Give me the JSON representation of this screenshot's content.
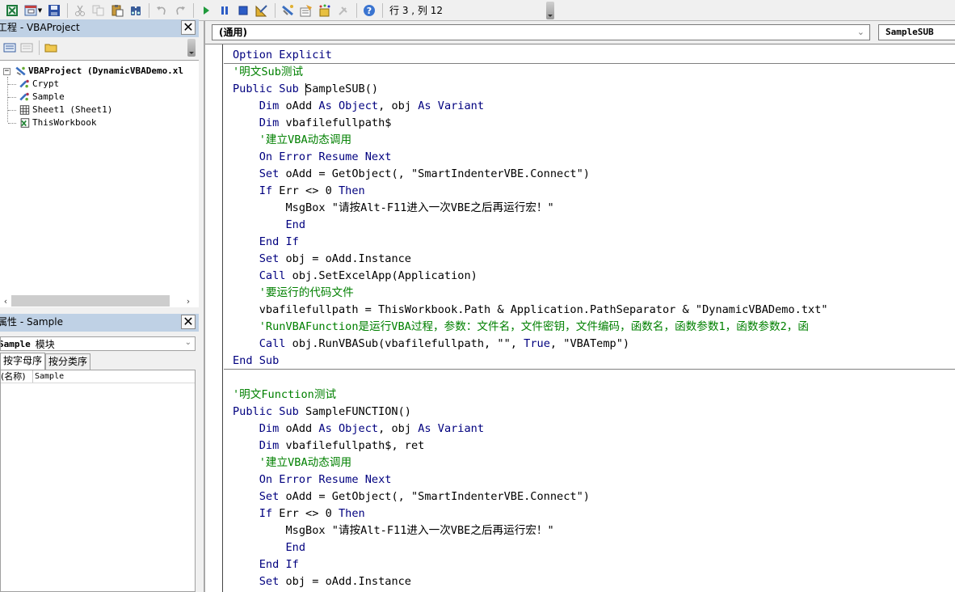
{
  "toolbar": {
    "buttons": [
      {
        "name": "view-excel-button",
        "icon": "excel-icon"
      },
      {
        "name": "insert-userform-button",
        "icon": "insert-userform-icon"
      },
      {
        "name": "save-button",
        "icon": "save-icon"
      },
      {
        "name": "cut-button",
        "icon": "cut-icon"
      },
      {
        "name": "copy-button",
        "icon": "copy-icon"
      },
      {
        "name": "paste-button",
        "icon": "paste-icon"
      },
      {
        "name": "find-button",
        "icon": "binoculars-icon"
      },
      {
        "name": "undo-button",
        "icon": "undo-icon"
      },
      {
        "name": "redo-button",
        "icon": "redo-icon"
      },
      {
        "name": "run-button",
        "icon": "play-icon"
      },
      {
        "name": "break-button",
        "icon": "pause-icon"
      },
      {
        "name": "reset-button",
        "icon": "stop-icon"
      },
      {
        "name": "design-mode-button",
        "icon": "design-mode-icon"
      },
      {
        "name": "project-explorer-button",
        "icon": "project-explorer-icon"
      },
      {
        "name": "properties-button",
        "icon": "properties-icon"
      },
      {
        "name": "object-browser-button",
        "icon": "object-browser-icon"
      },
      {
        "name": "toolbox-button",
        "icon": "toolbox-icon"
      },
      {
        "name": "help-button",
        "icon": "help-icon"
      }
    ],
    "cursor_position": "行 3 , 列 12"
  },
  "project_panel": {
    "title": "工程 - VBAProject",
    "close_label": "✕",
    "tools": [
      "view-code",
      "view-object",
      "toggle-folders"
    ],
    "tree": {
      "root": "VBAProject (DynamicVBADemo.xl",
      "expander": "−",
      "children": [
        {
          "label": "Crypt",
          "icon": "addin-module-icon"
        },
        {
          "label": "Sample",
          "icon": "addin-module-icon"
        },
        {
          "label": "Sheet1 (Sheet1)",
          "icon": "sheet-icon"
        },
        {
          "label": "ThisWorkbook",
          "icon": "workbook-icon"
        }
      ]
    },
    "scroll_left": "‹",
    "scroll_right": "›"
  },
  "properties_panel": {
    "title": "属性 - Sample",
    "close_label": "✕",
    "object_name": "Sample",
    "object_type": "模块",
    "tabs": [
      {
        "label": "按字母序",
        "active": true
      },
      {
        "label": "按分类序",
        "active": false
      }
    ],
    "rows": [
      {
        "key": "(名称)",
        "value": "Sample"
      }
    ]
  },
  "code_window": {
    "object_combo": "(通用)",
    "procedure_combo": "SampleSUB",
    "chevron": "⌄",
    "lines": [
      [
        {
          "t": "kw",
          "s": "Option Explicit"
        }
      ],
      [
        {
          "t": "cm",
          "s": "'明文Sub测试"
        }
      ],
      [
        {
          "t": "kw",
          "s": "Public Sub "
        },
        {
          "t": "cursor",
          "s": ""
        },
        {
          "t": "tx",
          "s": "SampleSUB()"
        }
      ],
      [
        {
          "t": "tx",
          "s": "    "
        },
        {
          "t": "kw",
          "s": "Dim"
        },
        {
          "t": "tx",
          "s": " oAdd "
        },
        {
          "t": "kw",
          "s": "As Object"
        },
        {
          "t": "tx",
          "s": ", obj "
        },
        {
          "t": "kw",
          "s": "As Variant"
        }
      ],
      [
        {
          "t": "tx",
          "s": "    "
        },
        {
          "t": "kw",
          "s": "Dim"
        },
        {
          "t": "tx",
          "s": " vbafilefullpath$"
        }
      ],
      [
        {
          "t": "tx",
          "s": "    "
        },
        {
          "t": "cm",
          "s": "'建立VBA动态调用"
        }
      ],
      [
        {
          "t": "tx",
          "s": "    "
        },
        {
          "t": "kw",
          "s": "On Error Resume Next"
        }
      ],
      [
        {
          "t": "tx",
          "s": "    "
        },
        {
          "t": "kw",
          "s": "Set"
        },
        {
          "t": "tx",
          "s": " oAdd = GetObject(, \"SmartIndenterVBE.Connect\")"
        }
      ],
      [
        {
          "t": "tx",
          "s": "    "
        },
        {
          "t": "kw",
          "s": "If"
        },
        {
          "t": "tx",
          "s": " Err <> 0 "
        },
        {
          "t": "kw",
          "s": "Then"
        }
      ],
      [
        {
          "t": "tx",
          "s": "        MsgBox \"请按Alt-F11进入一次VBE之后再运行宏！\""
        }
      ],
      [
        {
          "t": "tx",
          "s": "        "
        },
        {
          "t": "kw",
          "s": "End"
        }
      ],
      [
        {
          "t": "tx",
          "s": "    "
        },
        {
          "t": "kw",
          "s": "End If"
        }
      ],
      [
        {
          "t": "tx",
          "s": "    "
        },
        {
          "t": "kw",
          "s": "Set"
        },
        {
          "t": "tx",
          "s": " obj = oAdd.Instance"
        }
      ],
      [
        {
          "t": "tx",
          "s": "    "
        },
        {
          "t": "kw",
          "s": "Call"
        },
        {
          "t": "tx",
          "s": " obj.SetExcelApp(Application)"
        }
      ],
      [
        {
          "t": "tx",
          "s": "    "
        },
        {
          "t": "cm",
          "s": "'要运行的代码文件"
        }
      ],
      [
        {
          "t": "tx",
          "s": "    vbafilefullpath = ThisWorkbook.Path & Application.PathSeparator & \"DynamicVBADemo.txt\""
        }
      ],
      [
        {
          "t": "tx",
          "s": "    "
        },
        {
          "t": "cm",
          "s": "'RunVBAFunction是运行VBA过程，参数：文件名，文件密钥，文件编码，函数名，函数参数1，函数参数2，函"
        }
      ],
      [
        {
          "t": "tx",
          "s": "    "
        },
        {
          "t": "kw",
          "s": "Call"
        },
        {
          "t": "tx",
          "s": " obj.RunVBASub(vbafilefullpath, \"\", "
        },
        {
          "t": "kw",
          "s": "True"
        },
        {
          "t": "tx",
          "s": ", \"VBATemp\")"
        }
      ],
      [
        {
          "t": "kw",
          "s": "End Sub"
        }
      ],
      [
        {
          "t": "sep",
          "s": ""
        }
      ],
      [
        {
          "t": "cm",
          "s": "'明文Function测试"
        }
      ],
      [
        {
          "t": "kw",
          "s": "Public Sub"
        },
        {
          "t": "tx",
          "s": " SampleFUNCTION()"
        }
      ],
      [
        {
          "t": "tx",
          "s": "    "
        },
        {
          "t": "kw",
          "s": "Dim"
        },
        {
          "t": "tx",
          "s": " oAdd "
        },
        {
          "t": "kw",
          "s": "As Object"
        },
        {
          "t": "tx",
          "s": ", obj "
        },
        {
          "t": "kw",
          "s": "As Variant"
        }
      ],
      [
        {
          "t": "tx",
          "s": "    "
        },
        {
          "t": "kw",
          "s": "Dim"
        },
        {
          "t": "tx",
          "s": " vbafilefullpath$, ret"
        }
      ],
      [
        {
          "t": "tx",
          "s": "    "
        },
        {
          "t": "cm",
          "s": "'建立VBA动态调用"
        }
      ],
      [
        {
          "t": "tx",
          "s": "    "
        },
        {
          "t": "kw",
          "s": "On Error Resume Next"
        }
      ],
      [
        {
          "t": "tx",
          "s": "    "
        },
        {
          "t": "kw",
          "s": "Set"
        },
        {
          "t": "tx",
          "s": " oAdd = GetObject(, \"SmartIndenterVBE.Connect\")"
        }
      ],
      [
        {
          "t": "tx",
          "s": "    "
        },
        {
          "t": "kw",
          "s": "If"
        },
        {
          "t": "tx",
          "s": " Err <> 0 "
        },
        {
          "t": "kw",
          "s": "Then"
        }
      ],
      [
        {
          "t": "tx",
          "s": "        MsgBox \"请按Alt-F11进入一次VBE之后再运行宏！\""
        }
      ],
      [
        {
          "t": "tx",
          "s": "        "
        },
        {
          "t": "kw",
          "s": "End"
        }
      ],
      [
        {
          "t": "tx",
          "s": "    "
        },
        {
          "t": "kw",
          "s": "End If"
        }
      ],
      [
        {
          "t": "tx",
          "s": "    "
        },
        {
          "t": "kw",
          "s": "Set"
        },
        {
          "t": "tx",
          "s": " obj = oAdd.Instance"
        }
      ]
    ]
  },
  "colors": {
    "keyword": "#00007f",
    "comment": "#008000",
    "panel_title": "#bfd1e5"
  }
}
